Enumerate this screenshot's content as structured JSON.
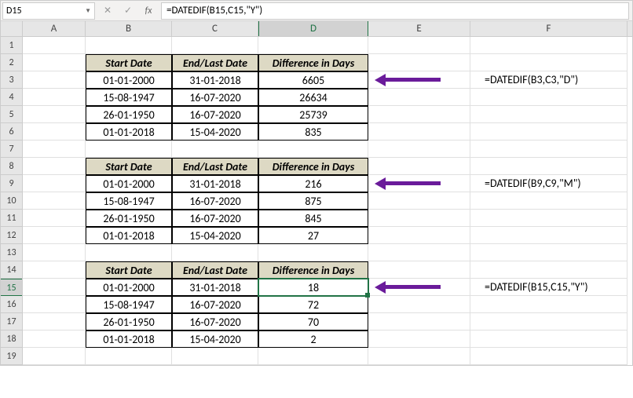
{
  "nameBox": "D15",
  "formula": "=DATEDIF(B15,C15,\"Y\")",
  "columns": [
    "A",
    "B",
    "C",
    "D",
    "E",
    "F"
  ],
  "rowNumbers": [
    "1",
    "2",
    "3",
    "4",
    "5",
    "6",
    "7",
    "8",
    "9",
    "10",
    "11",
    "12",
    "13",
    "14",
    "15",
    "16",
    "17",
    "18",
    "19"
  ],
  "selectedCol": "D",
  "selectedRow": "15",
  "tables": [
    {
      "headerRow": 2,
      "headers": [
        "Start Date",
        "End/Last Date",
        "Difference in Days"
      ],
      "rows": [
        [
          "01-01-2000",
          "31-01-2018",
          "6605"
        ],
        [
          "15-08-1947",
          "16-07-2020",
          "26634"
        ],
        [
          "26-01-1950",
          "16-07-2020",
          "25739"
        ],
        [
          "01-01-2018",
          "15-04-2020",
          "835"
        ]
      ],
      "annotation": "=DATEDIF(B3,C3,\"D\")",
      "arrowRow": 3
    },
    {
      "headerRow": 8,
      "headers": [
        "Start Date",
        "End/Last Date",
        "Difference in Days"
      ],
      "rows": [
        [
          "01-01-2000",
          "31-01-2018",
          "216"
        ],
        [
          "15-08-1947",
          "16-07-2020",
          "875"
        ],
        [
          "26-01-1950",
          "16-07-2020",
          "845"
        ],
        [
          "01-01-2018",
          "15-04-2020",
          "27"
        ]
      ],
      "annotation": "=DATEDIF(B9,C9,\"M\")",
      "arrowRow": 9
    },
    {
      "headerRow": 14,
      "headers": [
        "Start Date",
        "End/Last Date",
        "Difference in Days"
      ],
      "rows": [
        [
          "01-01-2000",
          "31-01-2018",
          "18"
        ],
        [
          "15-08-1947",
          "16-07-2020",
          "72"
        ],
        [
          "26-01-1950",
          "16-07-2020",
          "70"
        ],
        [
          "01-01-2018",
          "15-04-2020",
          "2"
        ]
      ],
      "annotation": "=DATEDIF(B15,C15,\"Y\")",
      "arrowRow": 15
    }
  ]
}
